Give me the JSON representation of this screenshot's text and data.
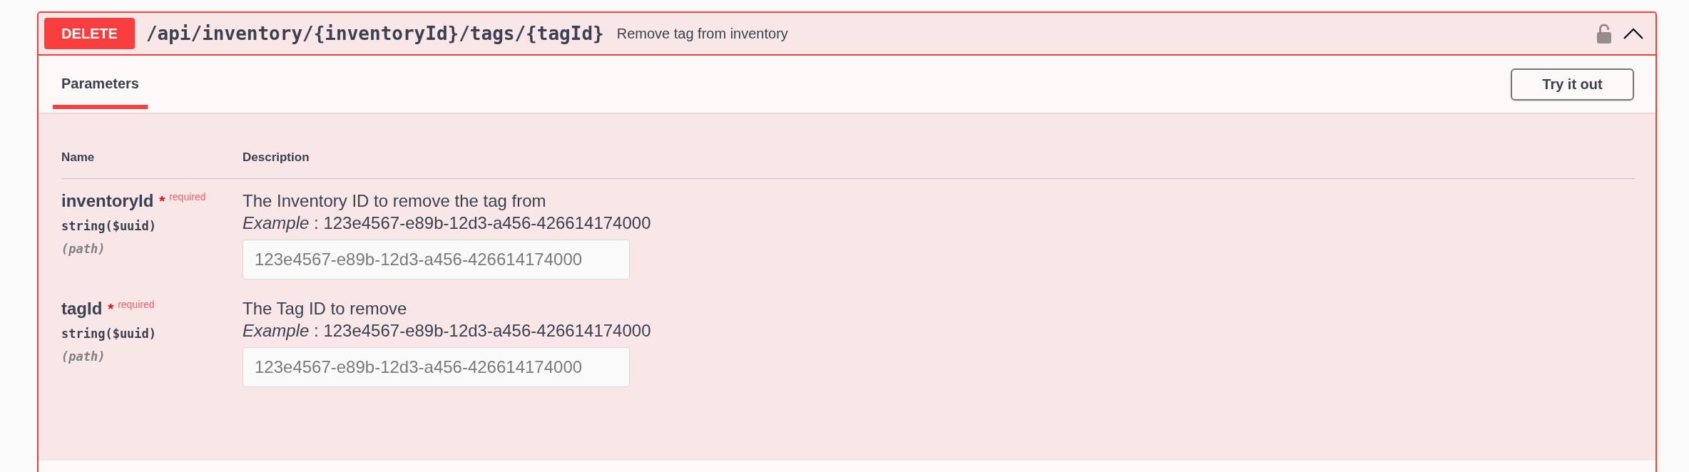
{
  "operation": {
    "method": "DELETE",
    "path": "/api/inventory/{inventoryId}/tags/{tagId}",
    "summary": "Remove tag from inventory",
    "locked": false,
    "expanded": true
  },
  "tabs": [
    {
      "label": "Parameters",
      "selected": true
    }
  ],
  "try_it_out_button": {
    "label": "Try it out"
  },
  "parameters": {
    "columns": [
      "Name",
      "Description"
    ],
    "rows": [
      {
        "name": "inventoryId",
        "required_mark": "*",
        "required_label": "required",
        "type": "string($uuid)",
        "location": "(path)",
        "description": "The Inventory ID to remove the tag from",
        "example": "*Example* : 123e4567-e89b-12d3-a456-426614174000",
        "input": {
          "placeholder": "123e4567-e89b-12d3-a456-426614174000"
        }
      },
      {
        "name": "tagId",
        "required_mark": "*",
        "required_label": "required",
        "type": "string($uuid)",
        "location": "(path)",
        "description": "The Tag ID to remove",
        "example": "*Example* : 123e4567-e89b-12d3-a456-426614174000",
        "input": {
          "placeholder": "123e4567-e89b-12d3-a456-426614174000"
        }
      }
    ]
  }
}
